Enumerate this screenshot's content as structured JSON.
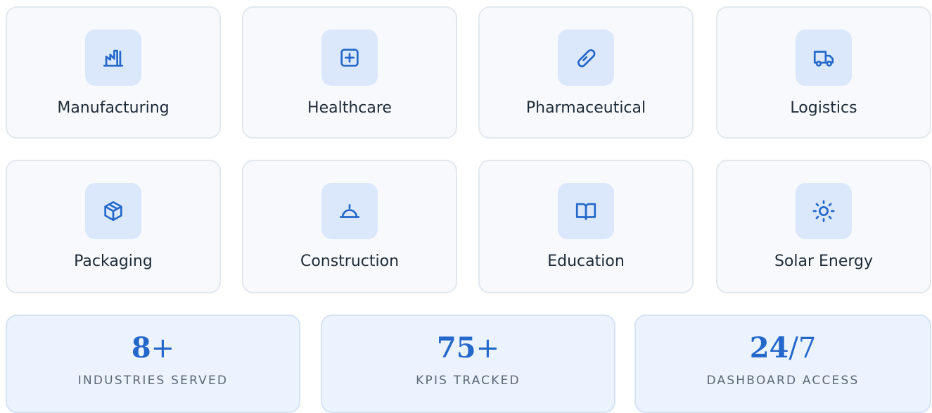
{
  "industries": [
    {
      "label": "Manufacturing",
      "icon": "factory-icon"
    },
    {
      "label": "Healthcare",
      "icon": "medical-plus-icon"
    },
    {
      "label": "Pharmaceutical",
      "icon": "pill-icon"
    },
    {
      "label": "Logistics",
      "icon": "truck-icon"
    },
    {
      "label": "Packaging",
      "icon": "package-icon"
    },
    {
      "label": "Construction",
      "icon": "hard-hat-icon"
    },
    {
      "label": "Education",
      "icon": "book-icon"
    },
    {
      "label": "Solar Energy",
      "icon": "sun-icon"
    }
  ],
  "stats": [
    {
      "value": "8",
      "suffix": "+",
      "label": "INDUSTRIES SERVED"
    },
    {
      "value": "75",
      "suffix": "+",
      "label": "KPIS TRACKED"
    },
    {
      "value": "24",
      "suffix": "/7",
      "label": "DASHBOARD ACCESS"
    }
  ],
  "colors": {
    "accent": "#2468c9",
    "icon_bg": "#dbe8fb",
    "card_bg": "#f7f9fc",
    "stat_bg": "#ebf3fe"
  }
}
